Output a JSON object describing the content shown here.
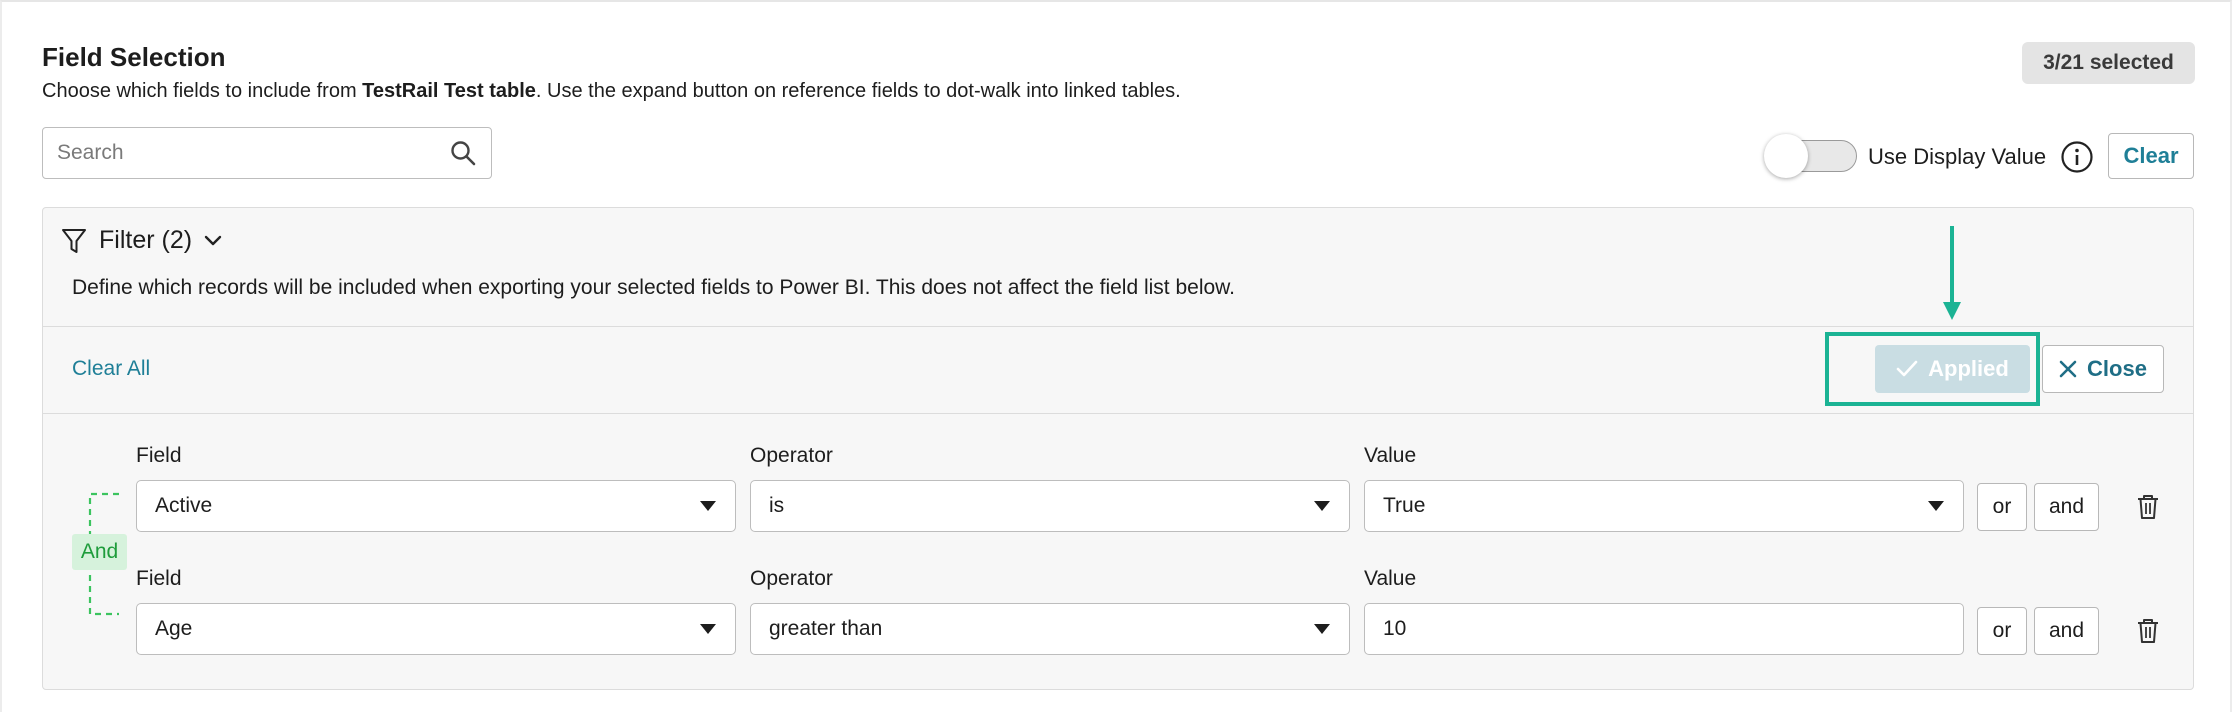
{
  "header": {
    "title": "Field Selection",
    "subtitle_prefix": "Choose which fields to include from ",
    "subtitle_table": "TestRail Test table",
    "subtitle_suffix": ". Use the expand button on reference fields to dot-walk into linked tables.",
    "selected_count": "3/21 selected"
  },
  "search": {
    "placeholder": "Search",
    "value": ""
  },
  "display_value": {
    "label": "Use Display Value",
    "enabled": false,
    "clear_label": "Clear"
  },
  "filter": {
    "title": "Filter (2)",
    "description": "Define which records will be included when exporting your selected fields to Power BI. This does not affect the field list below.",
    "clear_all_label": "Clear All",
    "applied_label": "Applied",
    "close_label": "Close",
    "conjunction_label": "And",
    "rows": [
      {
        "field_label": "Field",
        "field_value": "Active",
        "operator_label": "Operator",
        "operator_value": "is",
        "value_label": "Value",
        "value_value": "True",
        "or_label": "or",
        "and_label": "and"
      },
      {
        "field_label": "Field",
        "field_value": "Age",
        "operator_label": "Operator",
        "operator_value": "greater than",
        "value_label": "Value",
        "value_value": "10",
        "or_label": "or",
        "and_label": "and"
      }
    ]
  },
  "colors": {
    "accent": "#1f7f97",
    "highlight": "#1bb394",
    "applied_bg": "#c9dde3",
    "and_green": "#1e9c3b"
  }
}
